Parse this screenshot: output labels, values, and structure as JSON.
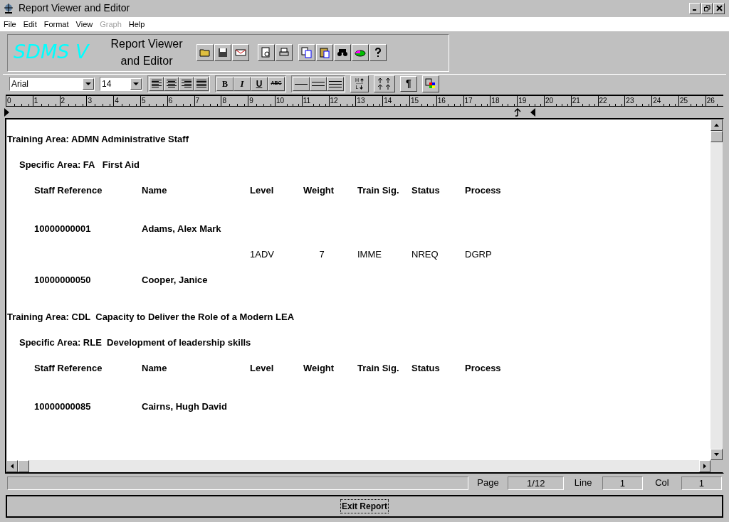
{
  "window": {
    "title": "Report Viewer and Editor"
  },
  "menu": [
    {
      "label": "File",
      "disabled": false
    },
    {
      "label": "Edit",
      "disabled": false
    },
    {
      "label": "Format",
      "disabled": false
    },
    {
      "label": "View",
      "disabled": false
    },
    {
      "label": "Graph",
      "disabled": true
    },
    {
      "label": "Help",
      "disabled": false
    }
  ],
  "banner": {
    "logo": "SDMS V",
    "title_line_1": "Report Viewer",
    "title_line_2": "and Editor"
  },
  "format_bar": {
    "font": "Arial",
    "size": "14",
    "style_buttons": [
      "B",
      "I",
      "U",
      "ABC"
    ],
    "spacing_buttons": [
      {
        "top": "H",
        "bottom": "L"
      }
    ],
    "paragraph": "¶"
  },
  "ruler": {
    "numbers": [
      "0",
      "1",
      "2",
      "3",
      "4",
      "5",
      "6",
      "7",
      "8",
      "9",
      "10",
      "11",
      "12",
      "13",
      "14",
      "15",
      "16",
      "17",
      "18",
      "19",
      "20",
      "21",
      "22",
      "23",
      "24",
      "25",
      "26"
    ]
  },
  "report": [
    {
      "training_area": "Training Area: ADMN Administrative Staff",
      "specific_area": "Specific Area: FA   First Aid",
      "columns": [
        "Staff Reference",
        "Name",
        "Level",
        "Weight",
        "Train Sig.",
        "Status",
        "Process"
      ],
      "rows": [
        {
          "kind": "staff",
          "staff_reference": "10000000001",
          "name": "Adams, Alex Mark"
        },
        {
          "kind": "detail",
          "level": "1ADV",
          "weight": "7",
          "train_sig": "IMME",
          "status": "NREQ",
          "process": "DGRP"
        },
        {
          "kind": "staff",
          "staff_reference": "10000000050",
          "name": "Cooper, Janice"
        }
      ]
    },
    {
      "training_area": "Training Area: CDL  Capacity to Deliver the Role of a Modern LEA",
      "specific_area": "Specific Area: RLE  Development of leadership skills",
      "columns": [
        "Staff Reference",
        "Name",
        "Level",
        "Weight",
        "Train Sig.",
        "Status",
        "Process"
      ],
      "rows": [
        {
          "kind": "staff",
          "staff_reference": "10000000085",
          "name": "Cairns, Hugh David"
        }
      ]
    }
  ],
  "status_bar": {
    "page_label": "Page",
    "page": "1/12",
    "line_label": "Line",
    "line": "1",
    "col_label": "Col",
    "col": "1"
  },
  "exit_button": "Exit Report"
}
